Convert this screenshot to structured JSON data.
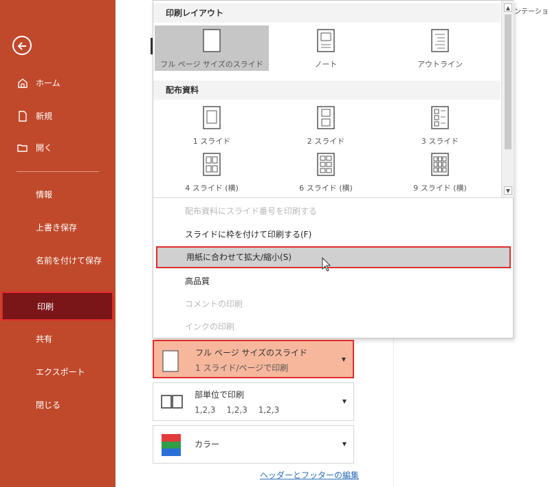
{
  "sidebar": {
    "items": [
      {
        "label": "ホーム",
        "icon": "home-icon"
      },
      {
        "label": "新規",
        "icon": "new-document-icon"
      },
      {
        "label": "開く",
        "icon": "folder-open-icon"
      },
      {
        "label": "情報"
      },
      {
        "label": "上書き保存"
      },
      {
        "label": "名前を付けて保存"
      },
      {
        "label": "印刷"
      },
      {
        "label": "共有"
      },
      {
        "label": "エクスポート"
      },
      {
        "label": "閉じる"
      }
    ]
  },
  "dropdown": {
    "print_layout_heading": "印刷レイアウト",
    "print_layout_options": [
      "フル ページ サイズのスライド",
      "ノート",
      "アウトライン"
    ],
    "handouts_heading": "配布資料",
    "handout_options": [
      "1 スライド",
      "2 スライド",
      "3 スライド",
      "4 スライド (横)",
      "6 スライド (横)",
      "9 スライド (横)"
    ],
    "menu_items": [
      {
        "label": "配布資料にスライド番号を印刷する",
        "enabled": false
      },
      {
        "label": "スライドに枠を付けて印刷する(F)",
        "enabled": true
      },
      {
        "label": "用紙に合わせて拡大/縮小(S)",
        "enabled": true,
        "highlighted": true
      },
      {
        "label": "高品質",
        "enabled": true
      },
      {
        "label": "コメントの印刷",
        "enabled": false
      },
      {
        "label": "インクの印刷",
        "enabled": false
      }
    ]
  },
  "settings": {
    "layout": {
      "line1": "フル ページ サイズのスライド",
      "line2": "1 スライド/ページで印刷"
    },
    "collate": {
      "line1": "部単位で印刷",
      "line2": "1,2,3　 1,2,3　 1,2,3"
    },
    "color": {
      "line1": "カラー"
    }
  },
  "footer_link": "ヘッダーとフッターの編集",
  "top_right_fragment": "ンテーショ",
  "colors": {
    "sidebar": "#c0492b",
    "active_nav": "#7a1518",
    "highlight_border": "#e02b2b",
    "active_setting": "#f6b79c"
  }
}
